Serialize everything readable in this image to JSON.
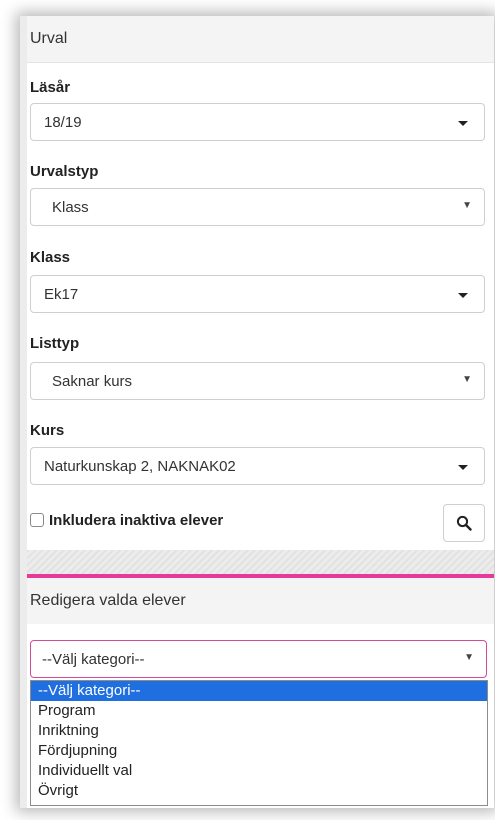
{
  "urval": {
    "title": "Urval",
    "lasar": {
      "label": "Läsår",
      "value": "18/19"
    },
    "urvalstyp": {
      "label": "Urvalstyp",
      "value": "Klass"
    },
    "klass": {
      "label": "Klass",
      "value": "Ek17"
    },
    "listtyp": {
      "label": "Listtyp",
      "value": "Saknar kurs"
    },
    "kurs": {
      "label": "Kurs",
      "value": "Naturkunskap 2, NAKNAK02"
    },
    "include_inactive": {
      "label": "Inkludera inaktiva elever",
      "checked": false
    },
    "search_icon": "search-icon"
  },
  "redigera": {
    "title": "Redigera valda elever",
    "category_select": {
      "value": "--Välj kategori--",
      "options": [
        "--Välj kategori--",
        "Program",
        "Inriktning",
        "Fördjupning",
        "Individuellt val",
        "Övrigt"
      ],
      "selected_index": 0
    }
  },
  "colors": {
    "accent": "#e6399b",
    "option_highlight": "#1f6fe0"
  }
}
